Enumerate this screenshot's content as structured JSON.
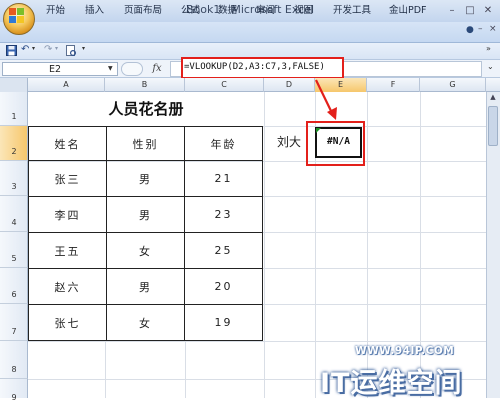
{
  "window": {
    "title": "Book1 - Microsoft Excel",
    "min_icon": "minimize-icon",
    "restore_icon": "restore-icon",
    "close_icon": "close-icon"
  },
  "ribbon": {
    "tabs": [
      "开始",
      "插入",
      "页面布局",
      "公式",
      "数据",
      "审阅",
      "视图",
      "开发工具",
      "金山PDF"
    ]
  },
  "formula_bar": {
    "name_box": "E2",
    "fx_label": "fx",
    "formula": "=VLOOKUP(D2,A3:C7,3,FALSE)"
  },
  "columns": [
    "A",
    "B",
    "C",
    "D",
    "E",
    "F",
    "G"
  ],
  "rows": [
    "1",
    "2",
    "3",
    "4",
    "5",
    "6",
    "7",
    "8",
    "9"
  ],
  "sheet": {
    "title": "人员花名册",
    "headers": [
      "姓名",
      "性别",
      "年龄"
    ],
    "records": [
      [
        "张三",
        "男",
        "21"
      ],
      [
        "李四",
        "男",
        "23"
      ],
      [
        "王五",
        "女",
        "25"
      ],
      [
        "赵六",
        "男",
        "20"
      ],
      [
        "张七",
        "女",
        "19"
      ]
    ],
    "lookup_value": "刘大",
    "result": "#N/A"
  },
  "annotation": {
    "box_color": "#e3201b",
    "arrow_color": "#e3201b"
  },
  "watermark": {
    "url": "WWW.94IP.COM",
    "text": "IT运维空间"
  }
}
